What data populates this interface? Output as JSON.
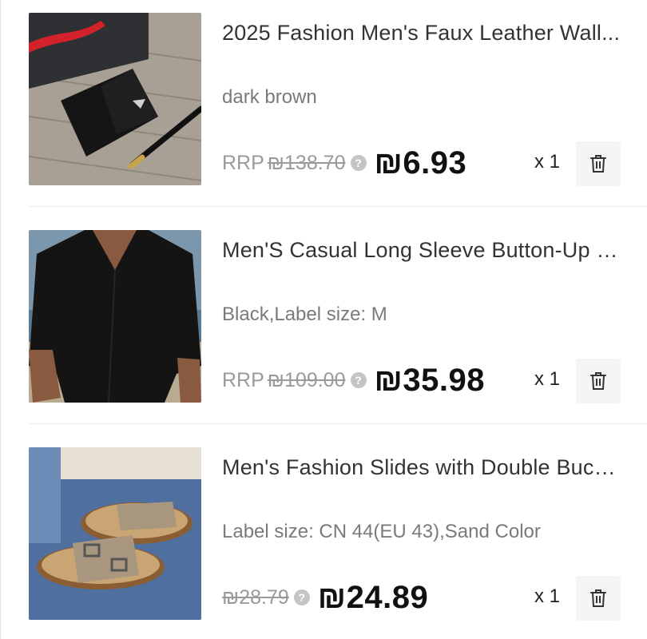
{
  "cart": {
    "items": [
      {
        "title": "2025 Fashion Men's Faux Leather Wall...",
        "variant": "dark brown",
        "rrp_label": "RRP",
        "rrp_value": "₪138.70",
        "price": "₪6.93",
        "quantity": "x 1",
        "image": "black-leather-wallet-photo"
      },
      {
        "title": "Men'S Casual Long Sleeve Button-Up S...",
        "variant": "Black,Label size: M",
        "rrp_label": "RRP",
        "rrp_value": "₪109.00",
        "price": "₪35.98",
        "quantity": "x 1",
        "image": "black-linen-shirt-photo"
      },
      {
        "title": "Men's Fashion Slides with Double Buck...",
        "variant": "Label size: CN 44(EU 43),Sand Color",
        "rrp_label": "",
        "rrp_value": "₪28.79",
        "price": "₪24.89",
        "quantity": "x 1",
        "image": "sand-double-buckle-slides-photo"
      }
    ]
  },
  "icons": {
    "help": "question-circle-icon",
    "delete": "trash-icon"
  },
  "colors": {
    "price": "#111111",
    "rrp": "#9a9a9a",
    "variant": "#7a7a7a",
    "delete_bg": "#f4f4f4"
  }
}
